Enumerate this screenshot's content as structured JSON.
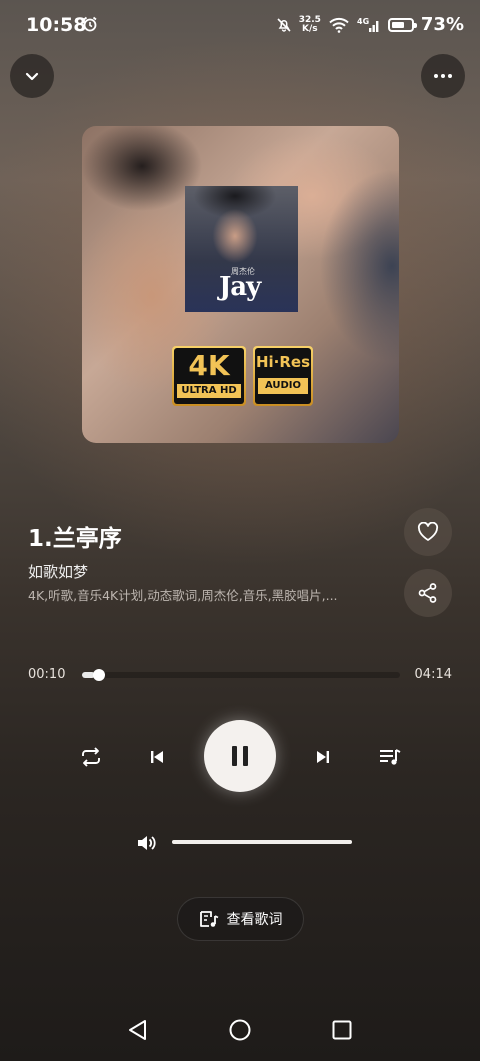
{
  "status_bar": {
    "time": "10:58",
    "net_speed_value": "32.5",
    "net_speed_unit": "K/s",
    "battery": "73%",
    "battery_level": 0.73
  },
  "player": {
    "track_title": "1.兰亭序",
    "album": "如歌如梦",
    "tags": "4K,听歌,音乐4K计划,动态歌词,周杰伦,音乐,黑胶唱片,...",
    "time_current": "00:10",
    "time_total": "04:14",
    "progress": 0.04,
    "volume": 1.0,
    "lyrics_label": "查看歌词"
  },
  "album_art": {
    "cover_text": "Jay",
    "cover_subtext": "周杰伦",
    "badge_4k": "4K",
    "badge_4k_sub": "ULTRA HD",
    "badge_hires": "Hi·Res",
    "badge_hires_sub": "AUDIO"
  },
  "icons": [
    "alarm-icon",
    "mute-icon",
    "wifi-icon",
    "signal-icon",
    "battery-icon",
    "chevron-down-icon",
    "more-icon",
    "heart-icon",
    "share-icon",
    "repeat-icon",
    "previous-icon",
    "pause-icon",
    "next-icon",
    "playlist-icon",
    "volume-icon",
    "lyrics-icon",
    "back-icon",
    "home-icon",
    "recents-icon"
  ]
}
